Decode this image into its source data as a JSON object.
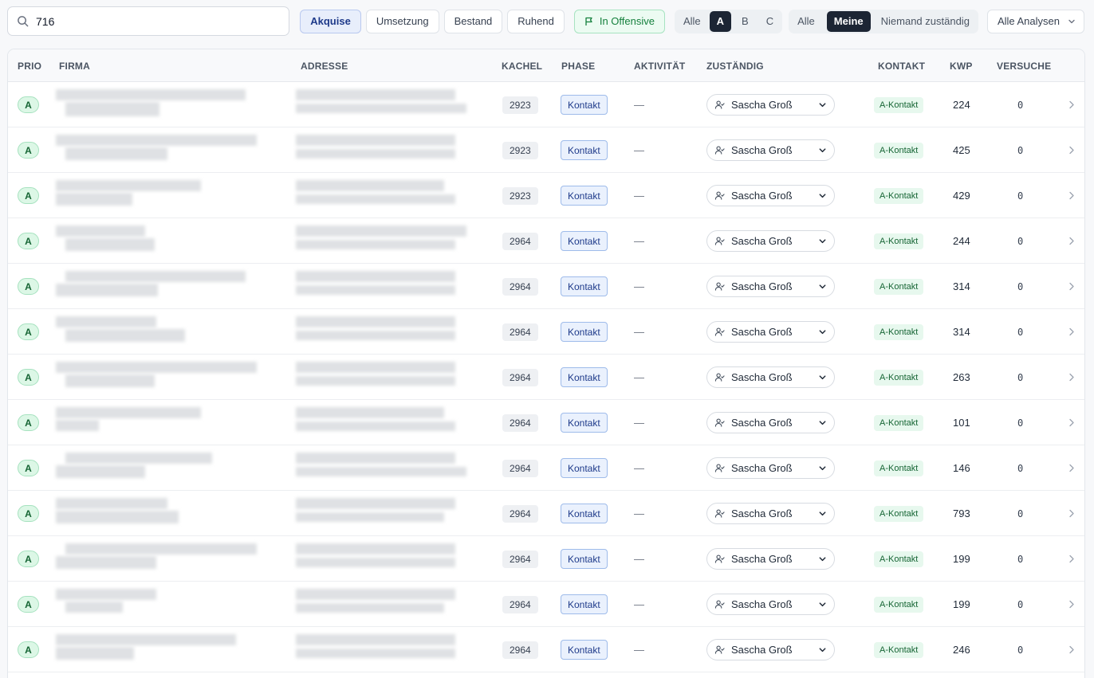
{
  "search": {
    "value": "716",
    "icon": "search-icon"
  },
  "phase_filters": [
    {
      "label": "Akquise",
      "active": true
    },
    {
      "label": "Umsetzung",
      "active": false
    },
    {
      "label": "Bestand",
      "active": false
    },
    {
      "label": "Ruhend",
      "active": false
    }
  ],
  "offensive_filter": {
    "label": "In Offensive",
    "icon": "flag-icon"
  },
  "prio_segment": [
    {
      "label": "Alle",
      "active": false
    },
    {
      "label": "A",
      "active": true
    },
    {
      "label": "B",
      "active": false
    },
    {
      "label": "C",
      "active": false
    }
  ],
  "owner_segment": [
    {
      "label": "Alle",
      "active": false
    },
    {
      "label": "Meine",
      "active": true
    },
    {
      "label": "Niemand zuständig",
      "active": false
    }
  ],
  "analysis_dropdown": {
    "label": "Alle Analysen",
    "icon": "chevron-down-icon"
  },
  "table": {
    "columns": {
      "prio": "PRIO",
      "firma": "FIRMA",
      "adresse": "ADRESSE",
      "kachel": "KACHEL",
      "phase": "PHASE",
      "aktivitaet": "AKTIVITÄT",
      "zustaendig": "ZUSTÄNDIG",
      "kontakt": "KONTAKT",
      "kwp": "KWP",
      "versuche": "VERSUCHE"
    },
    "rows": [
      {
        "prio": "A",
        "kachel": "2923",
        "phase": "Kontakt",
        "aktivitaet": "—",
        "zustaendig": "Sascha Groß",
        "kontakt": "A-Kontakt",
        "kwp": "224",
        "versuche": "0"
      },
      {
        "prio": "A",
        "kachel": "2923",
        "phase": "Kontakt",
        "aktivitaet": "—",
        "zustaendig": "Sascha Groß",
        "kontakt": "A-Kontakt",
        "kwp": "425",
        "versuche": "0"
      },
      {
        "prio": "A",
        "kachel": "2923",
        "phase": "Kontakt",
        "aktivitaet": "—",
        "zustaendig": "Sascha Groß",
        "kontakt": "A-Kontakt",
        "kwp": "429",
        "versuche": "0"
      },
      {
        "prio": "A",
        "kachel": "2964",
        "phase": "Kontakt",
        "aktivitaet": "—",
        "zustaendig": "Sascha Groß",
        "kontakt": "A-Kontakt",
        "kwp": "244",
        "versuche": "0"
      },
      {
        "prio": "A",
        "kachel": "2964",
        "phase": "Kontakt",
        "aktivitaet": "—",
        "zustaendig": "Sascha Groß",
        "kontakt": "A-Kontakt",
        "kwp": "314",
        "versuche": "0"
      },
      {
        "prio": "A",
        "kachel": "2964",
        "phase": "Kontakt",
        "aktivitaet": "—",
        "zustaendig": "Sascha Groß",
        "kontakt": "A-Kontakt",
        "kwp": "314",
        "versuche": "0"
      },
      {
        "prio": "A",
        "kachel": "2964",
        "phase": "Kontakt",
        "aktivitaet": "—",
        "zustaendig": "Sascha Groß",
        "kontakt": "A-Kontakt",
        "kwp": "263",
        "versuche": "0"
      },
      {
        "prio": "A",
        "kachel": "2964",
        "phase": "Kontakt",
        "aktivitaet": "—",
        "zustaendig": "Sascha Groß",
        "kontakt": "A-Kontakt",
        "kwp": "101",
        "versuche": "0"
      },
      {
        "prio": "A",
        "kachel": "2964",
        "phase": "Kontakt",
        "aktivitaet": "—",
        "zustaendig": "Sascha Groß",
        "kontakt": "A-Kontakt",
        "kwp": "146",
        "versuche": "0"
      },
      {
        "prio": "A",
        "kachel": "2964",
        "phase": "Kontakt",
        "aktivitaet": "—",
        "zustaendig": "Sascha Groß",
        "kontakt": "A-Kontakt",
        "kwp": "793",
        "versuche": "0"
      },
      {
        "prio": "A",
        "kachel": "2964",
        "phase": "Kontakt",
        "aktivitaet": "—",
        "zustaendig": "Sascha Groß",
        "kontakt": "A-Kontakt",
        "kwp": "199",
        "versuche": "0"
      },
      {
        "prio": "A",
        "kachel": "2964",
        "phase": "Kontakt",
        "aktivitaet": "—",
        "zustaendig": "Sascha Groß",
        "kontakt": "A-Kontakt",
        "kwp": "199",
        "versuche": "0"
      },
      {
        "prio": "A",
        "kachel": "2964",
        "phase": "Kontakt",
        "aktivitaet": "—",
        "zustaendig": "Sascha Groß",
        "kontakt": "A-Kontakt",
        "kwp": "246",
        "versuche": "0"
      }
    ]
  },
  "colors": {
    "accent_dark": "#1c2534",
    "phase_blue": "#1e3a8a",
    "prio_green": "#166534",
    "offensive_green": "#15803d"
  }
}
